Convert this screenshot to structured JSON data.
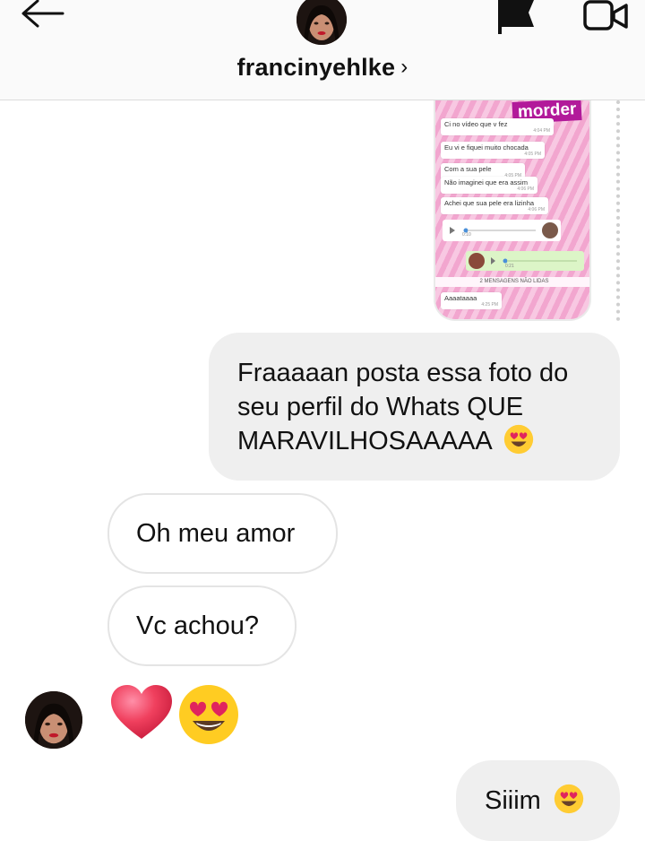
{
  "header": {
    "username": "francinyehlke",
    "chevron": "›",
    "icons": [
      "back-arrow-icon",
      "flag-icon",
      "video-call-icon"
    ]
  },
  "shared_image": {
    "brand": "morder",
    "messages": [
      {
        "text": "Ci no vídeo que v fez",
        "time": "4:04 PM"
      },
      {
        "text": "Eu vi e fiquei muito chocada",
        "time": "4:05 PM"
      },
      {
        "text": "Com a sua pele",
        "time": "4:05 PM"
      },
      {
        "text": "Não imaginei que era assim",
        "time": "4:06 PM"
      },
      {
        "text": "Achei que sua pele era lizinha",
        "time": "4:06 PM"
      },
      {
        "text": "Aaaataaaa",
        "time": "4:25 PM"
      }
    ],
    "audio1_duration": "0:10",
    "audio2_duration": "0:21",
    "unread_banner": "2 MENSAGENS NÃO LIDAS"
  },
  "messages": [
    {
      "direction": "outgoing",
      "text": "Fraaaaan posta essa foto do seu perfil do Whats QUE MARAVILHOSAAAAA",
      "emoji": "heart-eyes-emoji"
    },
    {
      "direction": "incoming",
      "text": "Oh meu amor"
    },
    {
      "direction": "incoming",
      "text": "Vc achou?"
    },
    {
      "direction": "incoming",
      "emojis": [
        "heart-emoji",
        "heart-eyes-emoji"
      ]
    },
    {
      "direction": "outgoing",
      "text": "Siiim",
      "emoji": "heart-eyes-emoji"
    }
  ],
  "colors": {
    "header_bg": "#fafafa",
    "outgoing_bubble": "#efefef",
    "incoming_border": "#e4e4e4",
    "brand_magenta": "#b21a9a"
  }
}
